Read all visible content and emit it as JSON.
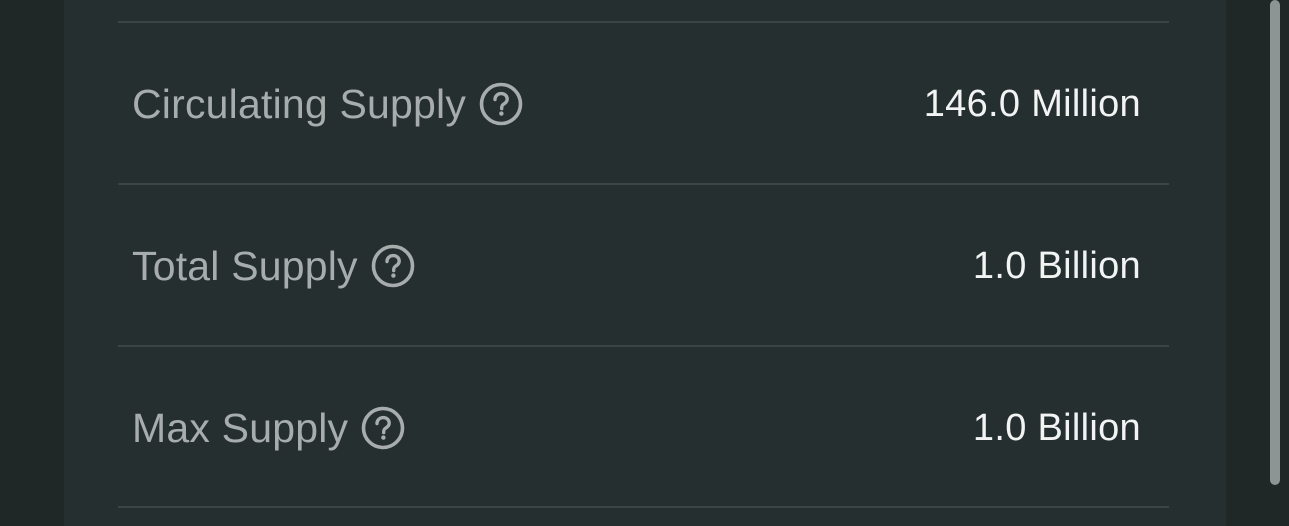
{
  "rows": [
    {
      "label": "Circulating Supply",
      "value": "146.0 Million",
      "icon": "help-circle-icon"
    },
    {
      "label": "Total Supply",
      "value": "1.0 Billion",
      "icon": "help-circle-icon"
    },
    {
      "label": "Max Supply",
      "value": "1.0 Billion",
      "icon": "help-circle-icon"
    }
  ],
  "colors": {
    "background": "#1f2827",
    "card": "#262f2f",
    "label": "#a6adac",
    "value": "#f2f4f4",
    "divider": "#3a4545"
  }
}
